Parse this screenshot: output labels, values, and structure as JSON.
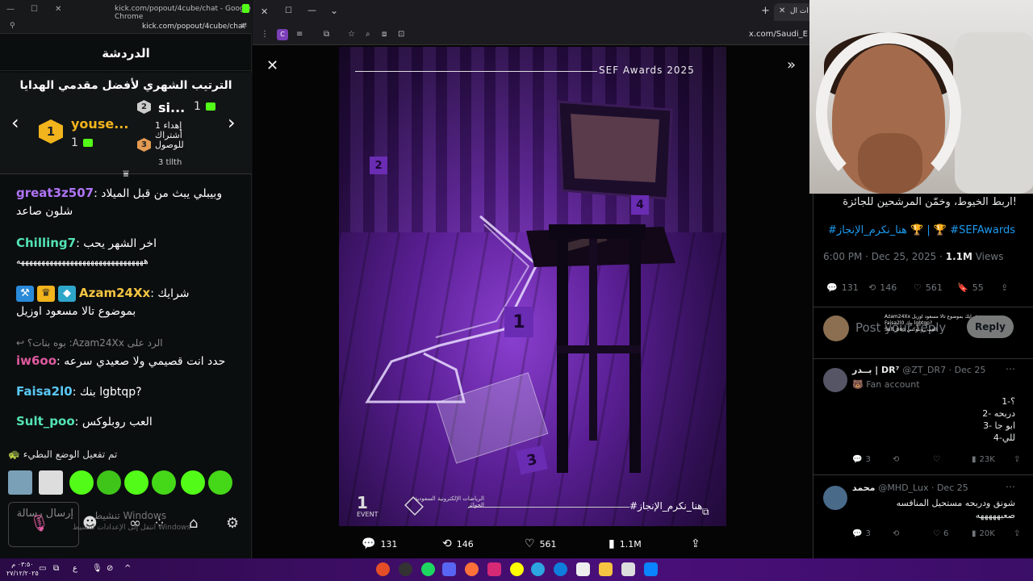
{
  "kick_window": {
    "title": "kick.com/popout/4cube/chat - Google Chrome",
    "url": "kick.com/popout/4cube/chat",
    "header": "الدردشة",
    "leaderboard": {
      "title": "الترتيب الشهري لأفضل مقدمي الهدايا",
      "first": {
        "rank": "1",
        "name": "youse...",
        "gifts": "1"
      },
      "second": {
        "rank": "2",
        "name": "si...",
        "gifts": "1"
      },
      "third": {
        "rank": "3",
        "text": "إهداء 1 أشتراك للوصول",
        "extra": "3 tllth"
      }
    },
    "messages": [
      {
        "user": "great3z507",
        "color": "#b074f7",
        "text": "وبيبلي يبث من قبل الميلاد",
        "text2": "شلون صاعد"
      },
      {
        "user": "Chilling7",
        "color": "#53e3b2",
        "text": "اخر الشهر يحب",
        "text2": "هههههههههههههههههههههههههههههههه"
      },
      {
        "user": "Azam24Xx",
        "color": "#f5c542",
        "text": "شرايك",
        "text2": "بموضوع تالا مسعود اوزيل"
      },
      {
        "reply_prefix": "الرد على",
        "reply_user": "Azam24Xx",
        "reply_text": "بوه بنات؟",
        "user": "iw6oo",
        "color": "#e05aa0",
        "text": "حدد انت قصيمي ولا صعيدي سرعه"
      },
      {
        "user": "Faisa2l0",
        "color": "#5ac8f5",
        "text": "بنك lgbtqp?"
      },
      {
        "user": "Sult_poo",
        "color": "#53e3b2",
        "text": "العب روبلوكس"
      }
    ],
    "slowmode": "تم تفعيل الوضع البطيء",
    "input_placeholder": "إرسال رسالة",
    "windows_watermark": "تنشيط Windows",
    "windows_watermark_sub": "انتقل إلى الإعدادات لتنشيط Windows"
  },
  "browser": {
    "tab_title": "ات ال",
    "url": "x.com/Saudi_E",
    "viewer": {
      "poster_title": "SEF Awards 2025",
      "poster_hashtag": "#هنا_نكرم_الإنجاز",
      "poster_org": "الرياضات الإلكترونية السعودية الجوائز",
      "poster_event": "EVENT",
      "markers": [
        "1",
        "2",
        "3",
        "4"
      ],
      "actions": {
        "replies": "131",
        "reposts": "146",
        "likes": "561",
        "views": "1.1M"
      }
    }
  },
  "tweet": {
    "text": "اربط الخيوط، وخمّن المرشحين للجائزة!",
    "hashtags": "#هنا_نكرم_الإنجاز 🏆 | 🏆 #SEFAwards",
    "time": "6:00 PM · Dec 25, 2025 · ",
    "views_count": "1.1M",
    "views_label": " Views",
    "stats": {
      "replies": "131",
      "reposts": "146",
      "likes": "561",
      "bookmarks": "55"
    },
    "reply_placeholder": "Post your reply",
    "reply_button": "Reply",
    "overlay_chat": [
      "Azam24Xx شرايك بموضوع تالا مسعود اوزيل",
      "Faisa2l0 بنك lgbtqp?",
      "Sult_poo العب روبلوكس"
    ],
    "comments": [
      {
        "name": "بــدر | DR⁷",
        "handle": "@ZT_DR7 · Dec 25",
        "sub": "Fan account",
        "body": "1-؟\n2- دربحه\n3- ابو جا\n4-للي",
        "replies": "3",
        "likes": "",
        "views": "23K"
      },
      {
        "name": "محمد",
        "handle": "@MHD_Lux · Dec 25",
        "sub": "",
        "body": "شونق ودربحه مستحيل المنافسه\nصعبهههههه",
        "replies": "3",
        "likes": "6",
        "views": "20K"
      }
    ]
  },
  "taskbar": {
    "time": "٠٣:٥٠ م",
    "date": "٢٧/١٢/٢٠٢٥",
    "lang": "ع"
  },
  "colors": {
    "accent_green": "#53fc18",
    "x_blue": "#1d9bf0",
    "purple": "#6a2cb3"
  }
}
